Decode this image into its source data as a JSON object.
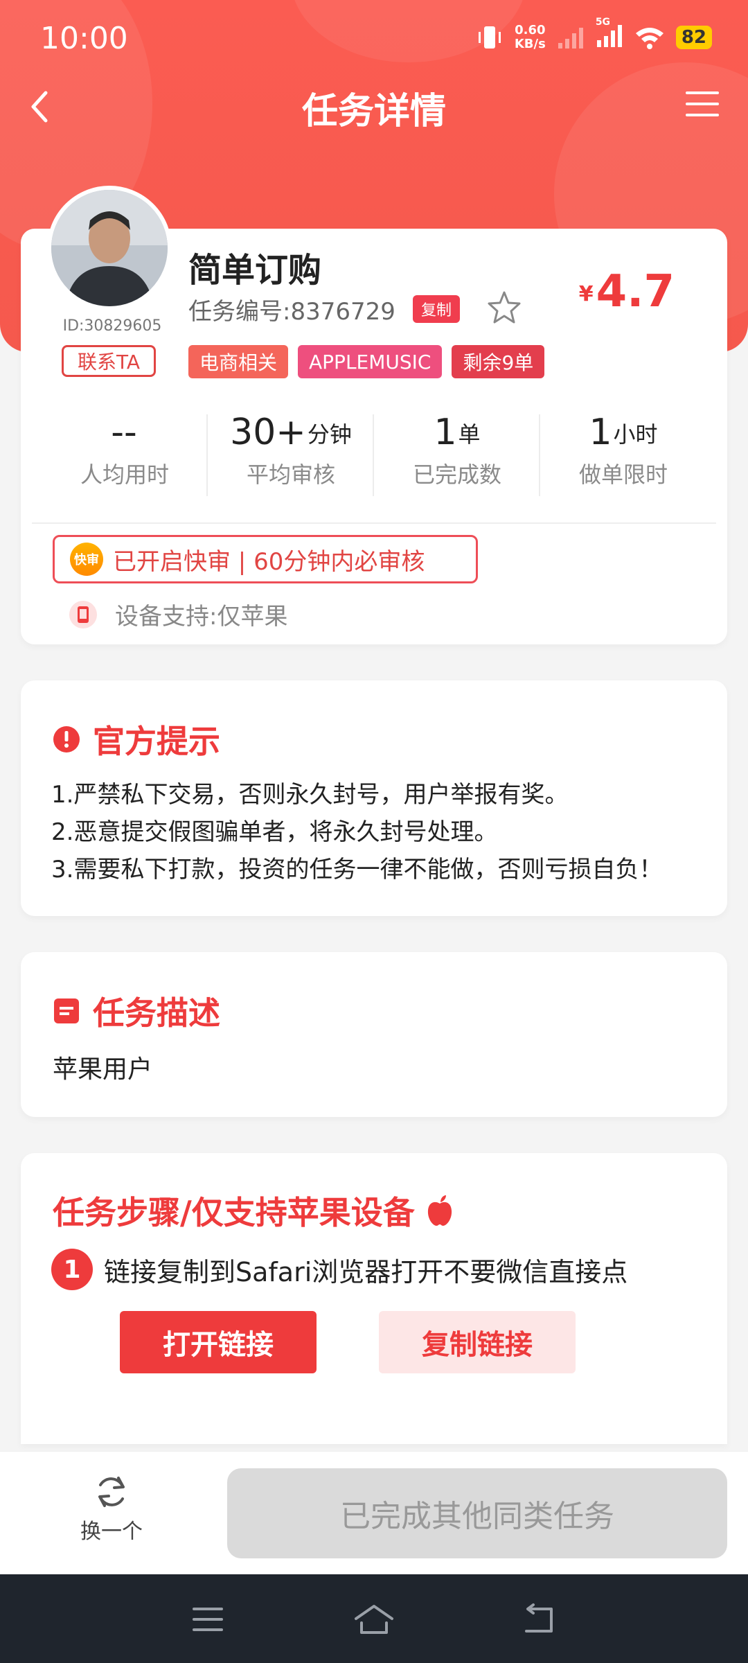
{
  "status_bar": {
    "time": "10:00",
    "net_speed_value": "0.60",
    "net_speed_unit": "KB/s",
    "network": "5G",
    "battery": "82"
  },
  "nav": {
    "title": "任务详情"
  },
  "task": {
    "title": "简单订购",
    "number": "任务编号:8376729",
    "copy_label": "复制",
    "price_symbol": "¥",
    "price": "4.7",
    "user_id": "ID:30829605",
    "contact_label": "联系TA",
    "tags": [
      {
        "label": "电商相关",
        "color": "#f4655a"
      },
      {
        "label": "APPLEMUSIC",
        "color": "#ee4f7e"
      },
      {
        "label": "剩余9单",
        "color": "#e33e4d"
      }
    ],
    "stats": [
      {
        "value": "--",
        "unit": "",
        "label": "人均用时"
      },
      {
        "value": "30+",
        "unit": "分钟",
        "label": "平均审核"
      },
      {
        "value": "1",
        "unit": "单",
        "label": "已完成数"
      },
      {
        "value": "1",
        "unit": "小时",
        "label": "做单限时"
      }
    ],
    "fast_review_icon": "快审",
    "fast_review": "已开启快审 | 60分钟内必审核",
    "device_support": "设备支持:仅苹果"
  },
  "notice": {
    "title": "官方提示",
    "lines": [
      "1.严禁私下交易，否则永久封号，用户举报有奖。",
      "2.恶意提交假图骗单者，将永久封号处理。",
      "3.需要私下打款，投资的任务一律不能做，否则亏损自负！"
    ]
  },
  "description": {
    "title": "任务描述",
    "text": "苹果用户"
  },
  "steps": {
    "title": "任务步骤/仅支持苹果设备",
    "items": [
      {
        "num": "1",
        "text": "链接复制到Safari浏览器打开不要微信直接点"
      }
    ],
    "open_link": "打开链接",
    "copy_link": "复制链接"
  },
  "bottom": {
    "switch_label": "换一个",
    "done_label": "已完成其他同类任务"
  },
  "colors": {
    "accent": "#ee3b3c",
    "header": "#f95b50"
  }
}
